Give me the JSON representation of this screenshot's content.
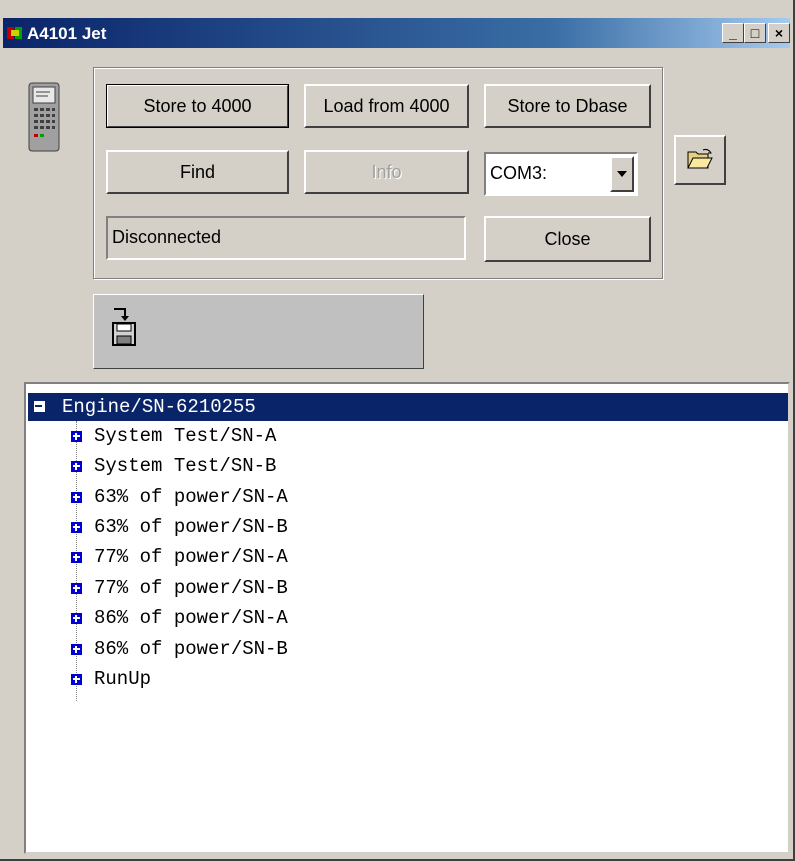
{
  "window": {
    "title": "A4101 Jet"
  },
  "titlebar_buttons": {
    "minimize": "_",
    "maximize": "□",
    "close": "×"
  },
  "toolbar": {
    "store_to_4000": "Store to 4000",
    "load_from_4000": "Load from 4000",
    "store_to_dbase": "Store to Dbase",
    "find": "Find",
    "info": "Info",
    "close": "Close"
  },
  "port": {
    "selected": "COM3:"
  },
  "status": {
    "text": "Disconnected"
  },
  "tree": {
    "root": "Engine/SN-6210255",
    "children": [
      "System Test/SN-A",
      "System Test/SN-B",
      "63% of power/SN-A",
      "63% of power/SN-B",
      "77% of power/SN-A",
      "77% of power/SN-B",
      "86% of power/SN-A",
      "86% of power/SN-B",
      "RunUp"
    ]
  },
  "icons": {
    "app": "app-icon",
    "device": "handheld-device-icon",
    "open": "open-folder-icon",
    "save": "save-to-disk-icon"
  },
  "colors": {
    "titlebar": "#0a246a",
    "selection": "#0a246a",
    "face": "#d4d0c8"
  }
}
